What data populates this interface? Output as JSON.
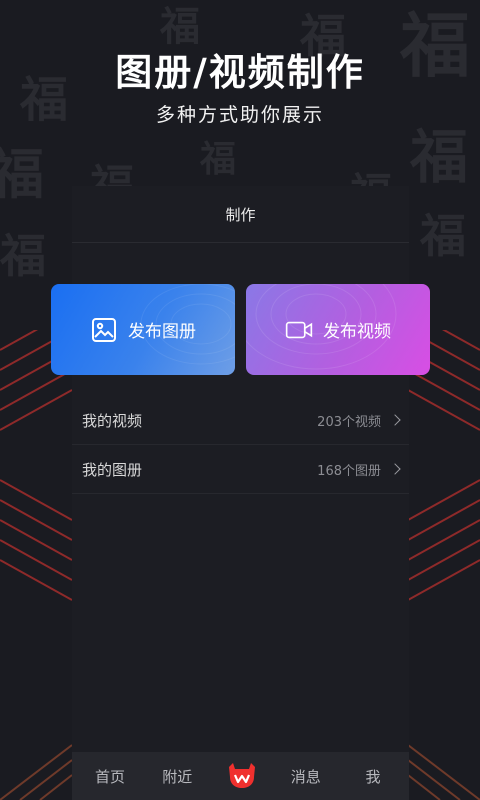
{
  "hero": {
    "title": "图册/视频制作",
    "subtitle": "多种方式助你展示"
  },
  "screen": {
    "title": "制作"
  },
  "cards": {
    "album": {
      "label": "发布图册",
      "icon": "image-icon",
      "color": "#1a6ff2"
    },
    "video": {
      "label": "发布视频",
      "icon": "video-camera-icon",
      "color": "#c055e2"
    }
  },
  "list": [
    {
      "label": "我的视频",
      "count": "203个视频"
    },
    {
      "label": "我的图册",
      "count": "168个图册"
    }
  ],
  "tabbar": {
    "home": "首页",
    "nearby": "附近",
    "center_icon": "logo-icon",
    "messages": "消息",
    "me": "我"
  },
  "background": {
    "watermark_char": "福"
  },
  "colors": {
    "accent_red": "#f0302e",
    "stripe_red": "#8e2a2a"
  }
}
